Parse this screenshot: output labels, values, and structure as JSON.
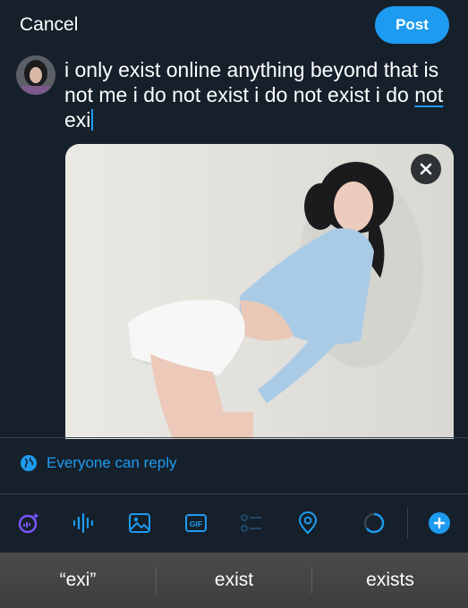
{
  "header": {
    "cancel_label": "Cancel",
    "post_label": "Post"
  },
  "compose": {
    "text_before": "i only exist online anything beyond that is not me i do not exist i do not exist i do ",
    "underlined_word": "not",
    "text_after": " exi",
    "avatar_icon": "profile-avatar"
  },
  "media": {
    "close_icon": "close-icon"
  },
  "reply_setting": {
    "label": "Everyone can reply",
    "icon": "globe-icon"
  },
  "toolbar": {
    "items": [
      "grok-sparkle-icon",
      "voice-icon",
      "image-icon",
      "gif-icon",
      "poll-icon",
      "location-icon",
      "char-progress-icon",
      "add-thread-icon"
    ]
  },
  "keyboard_suggestions": [
    "“exi”",
    "exist",
    "exists"
  ],
  "colors": {
    "accent": "#1d9bf0",
    "background": "#15202b",
    "divider": "#38444d"
  }
}
